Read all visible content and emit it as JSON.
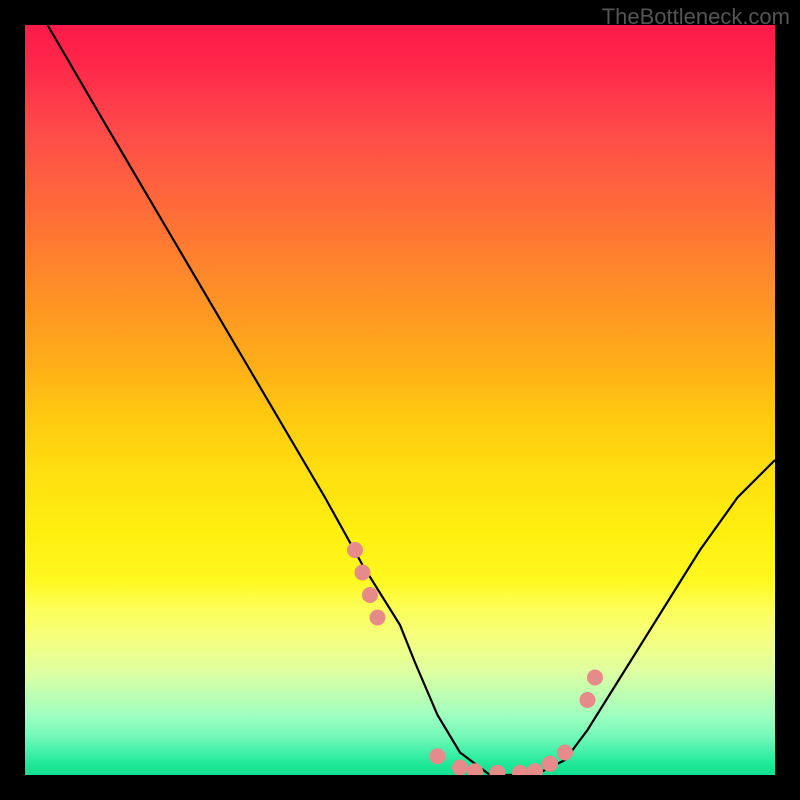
{
  "watermark": "TheBottleneck.com",
  "chart_data": {
    "type": "line",
    "title": "",
    "xlabel": "",
    "ylabel": "",
    "xlim": [
      0,
      100
    ],
    "ylim": [
      0,
      100
    ],
    "grid": false,
    "series": [
      {
        "name": "curve",
        "x": [
          3,
          10,
          20,
          30,
          40,
          45,
          50,
          52,
          55,
          58,
          62,
          65,
          68,
          72,
          75,
          80,
          85,
          90,
          95,
          100
        ],
        "values": [
          100,
          88,
          71,
          54,
          37,
          28,
          20,
          15,
          8,
          3,
          0,
          0,
          0,
          2,
          6,
          14,
          22,
          30,
          37,
          42
        ]
      }
    ],
    "markers": {
      "name": "dots",
      "color": "#e68a8a",
      "x": [
        44,
        45,
        46,
        47,
        55,
        58,
        60,
        63,
        66,
        68,
        70,
        72,
        75,
        76
      ],
      "values": [
        30,
        27,
        24,
        21,
        2.5,
        1.0,
        0.5,
        0.3,
        0.3,
        0.5,
        1.5,
        3,
        10,
        13
      ]
    },
    "background_gradient": {
      "top": "#ff1a4a",
      "upper_mid": "#ffaa1a",
      "mid": "#fff010",
      "lower_mid": "#e0ffa0",
      "bottom": "#10e090"
    }
  }
}
